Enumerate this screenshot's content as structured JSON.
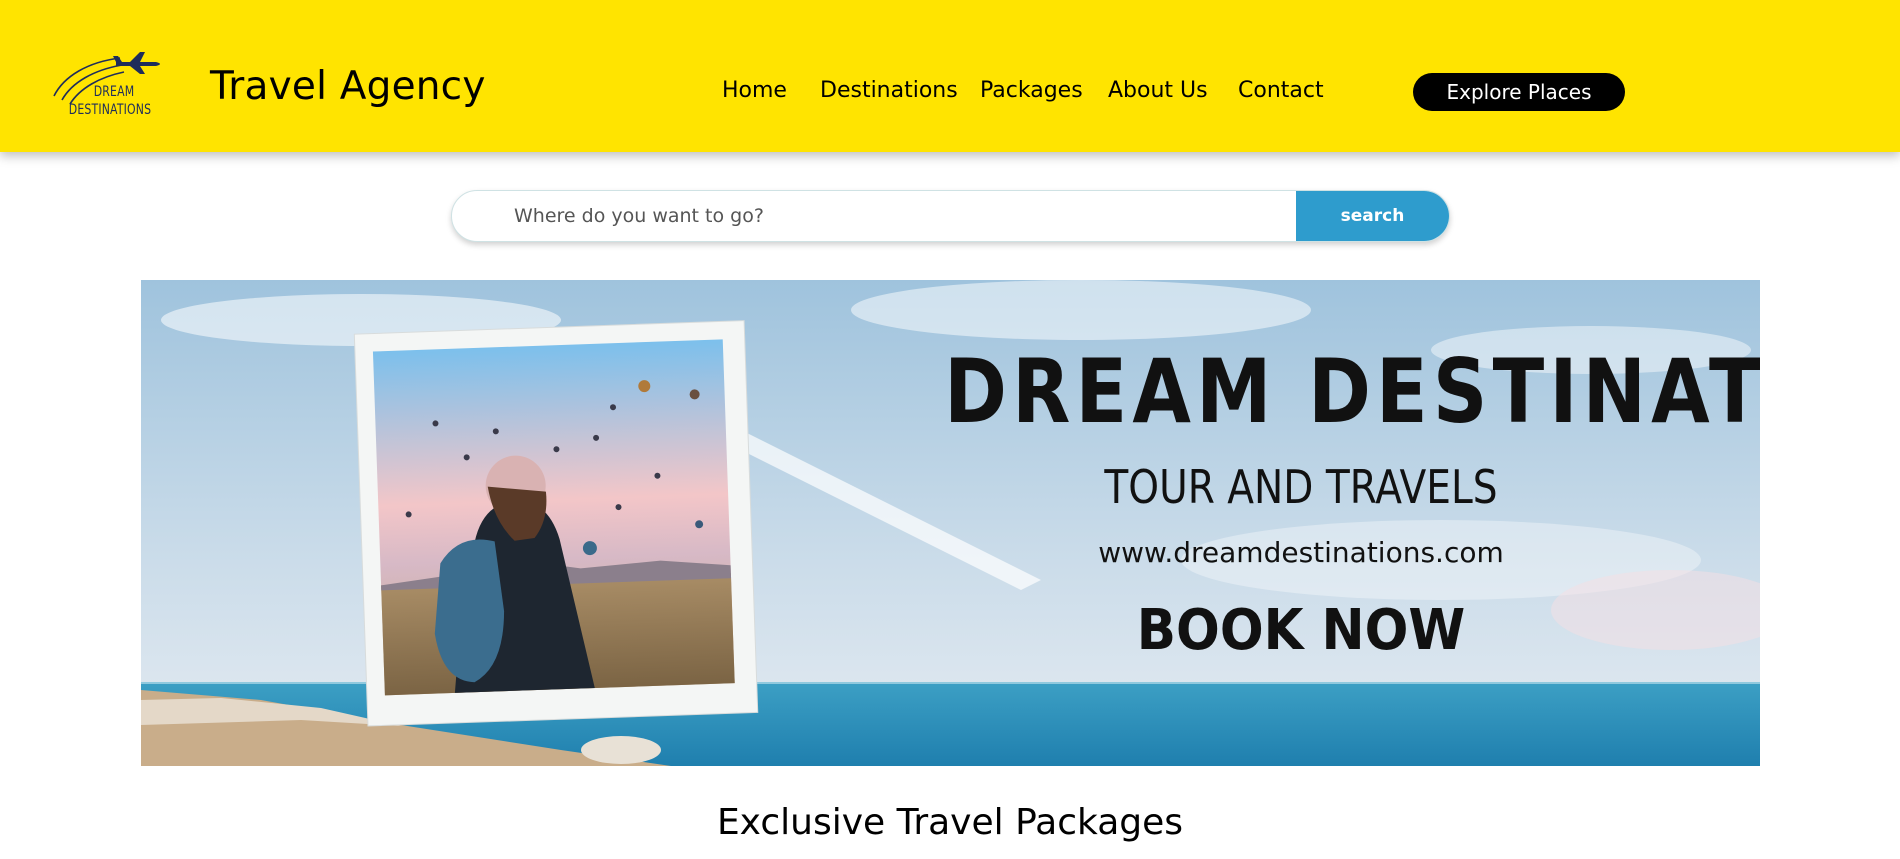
{
  "header": {
    "logo_line1": "DREAM",
    "logo_line2": "DESTINATIONS",
    "brand": "Travel Agency",
    "nav": [
      {
        "label": "Home"
      },
      {
        "label": "Destinations"
      },
      {
        "label": "Packages"
      },
      {
        "label": "About Us"
      },
      {
        "label": "Contact"
      }
    ],
    "cta_label": "Explore Places",
    "background": "#ffe400"
  },
  "search": {
    "placeholder": "Where do you want to go?",
    "value": "",
    "button_label": "search",
    "button_color": "#2e9ccd"
  },
  "banner": {
    "title": "DREAM DESTINATION",
    "subtitle": "TOUR AND TRAVELS",
    "url": "www.dreamdestinations.com",
    "cta": "BOOK NOW",
    "photo": "traveler-with-backpack-watching-hot-air-balloons"
  },
  "main": {
    "section_title": "Exclusive Travel Packages"
  },
  "icons": {
    "logo": "airplane-icon"
  }
}
